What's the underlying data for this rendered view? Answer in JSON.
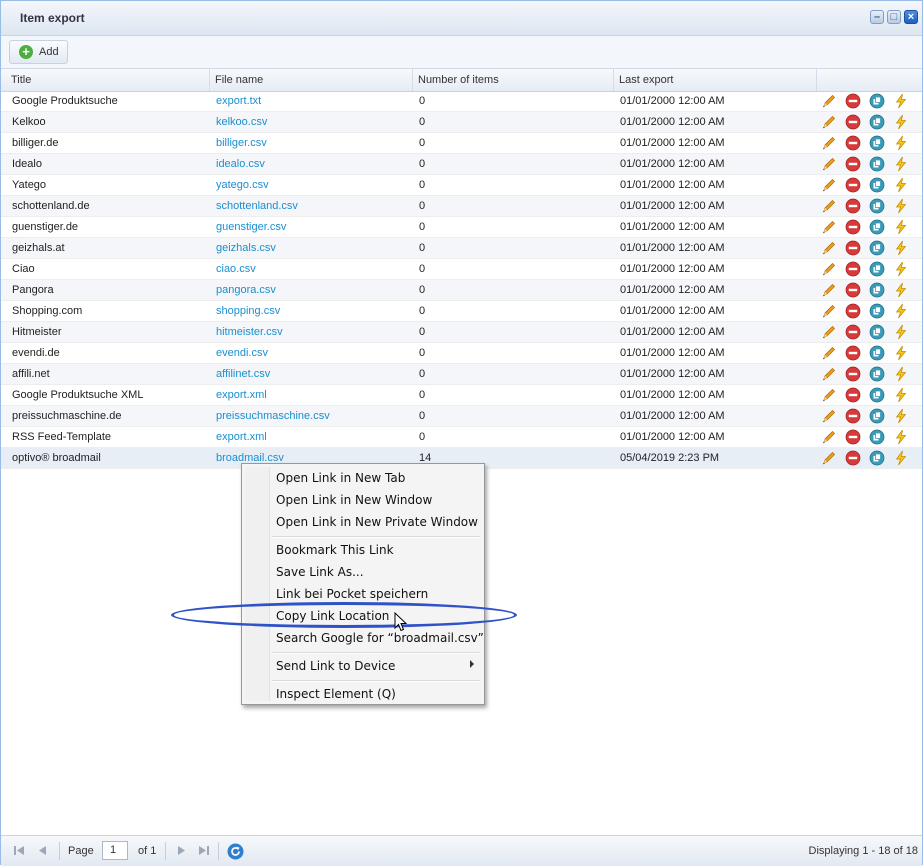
{
  "window": {
    "title": "Item export"
  },
  "toolbar": {
    "add_label": "Add"
  },
  "columns": {
    "title": "Title",
    "file": "File name",
    "num": "Number of items",
    "last": "Last export"
  },
  "rows": [
    {
      "title": "Google Produktsuche",
      "file": "export.txt",
      "num": "0",
      "last": "01/01/2000 12:00 AM"
    },
    {
      "title": "Kelkoo",
      "file": "kelkoo.csv",
      "num": "0",
      "last": "01/01/2000 12:00 AM"
    },
    {
      "title": "billiger.de",
      "file": "billiger.csv",
      "num": "0",
      "last": "01/01/2000 12:00 AM"
    },
    {
      "title": "Idealo",
      "file": "idealo.csv",
      "num": "0",
      "last": "01/01/2000 12:00 AM"
    },
    {
      "title": "Yatego",
      "file": "yatego.csv",
      "num": "0",
      "last": "01/01/2000 12:00 AM"
    },
    {
      "title": "schottenland.de",
      "file": "schottenland.csv",
      "num": "0",
      "last": "01/01/2000 12:00 AM"
    },
    {
      "title": "guenstiger.de",
      "file": "guenstiger.csv",
      "num": "0",
      "last": "01/01/2000 12:00 AM"
    },
    {
      "title": "geizhals.at",
      "file": "geizhals.csv",
      "num": "0",
      "last": "01/01/2000 12:00 AM"
    },
    {
      "title": "Ciao",
      "file": "ciao.csv",
      "num": "0",
      "last": "01/01/2000 12:00 AM"
    },
    {
      "title": "Pangora",
      "file": "pangora.csv",
      "num": "0",
      "last": "01/01/2000 12:00 AM"
    },
    {
      "title": "Shopping.com",
      "file": "shopping.csv",
      "num": "0",
      "last": "01/01/2000 12:00 AM"
    },
    {
      "title": "Hitmeister",
      "file": "hitmeister.csv",
      "num": "0",
      "last": "01/01/2000 12:00 AM"
    },
    {
      "title": "evendi.de",
      "file": "evendi.csv",
      "num": "0",
      "last": "01/01/2000 12:00 AM"
    },
    {
      "title": "affili.net",
      "file": "affilinet.csv",
      "num": "0",
      "last": "01/01/2000 12:00 AM"
    },
    {
      "title": "Google Produktsuche XML",
      "file": "export.xml",
      "num": "0",
      "last": "01/01/2000 12:00 AM"
    },
    {
      "title": "preissuchmaschine.de",
      "file": "preissuchmaschine.csv",
      "num": "0",
      "last": "01/01/2000 12:00 AM"
    },
    {
      "title": "RSS Feed-Template",
      "file": "export.xml",
      "num": "0",
      "last": "01/01/2000 12:00 AM"
    },
    {
      "title": "optivo® broadmail",
      "file": "broadmail.csv",
      "num": "14",
      "last": "05/04/2019 2:23 PM"
    }
  ],
  "context_menu": {
    "open_new_tab": "Open Link in New Tab",
    "open_new_window": "Open Link in New Window",
    "open_private": "Open Link in New Private Window",
    "bookmark": "Bookmark This Link",
    "save_as": "Save Link As...",
    "pocket": "Link bei Pocket speichern",
    "copy_location": "Copy Link Location",
    "search_google": "Search Google for “broadmail.csv”",
    "send_device": "Send Link to Device",
    "inspect": "Inspect Element (Q)"
  },
  "pager": {
    "page_label": "Page",
    "page_value": "1",
    "of_label": "of 1",
    "displaying": "Displaying 1 - 18 of 18"
  },
  "icons": [
    "minimize-icon",
    "maximize-icon",
    "close-icon",
    "add-icon",
    "edit-icon",
    "delete-icon",
    "duplicate-icon",
    "run-export-icon",
    "first-page-icon",
    "prev-page-icon",
    "next-page-icon",
    "last-page-icon",
    "refresh-icon",
    "cursor-icon"
  ],
  "colors": {
    "link": "#1a8fd0",
    "annotation_circle": "#2f52c7",
    "header_border": "#99bbe8"
  }
}
